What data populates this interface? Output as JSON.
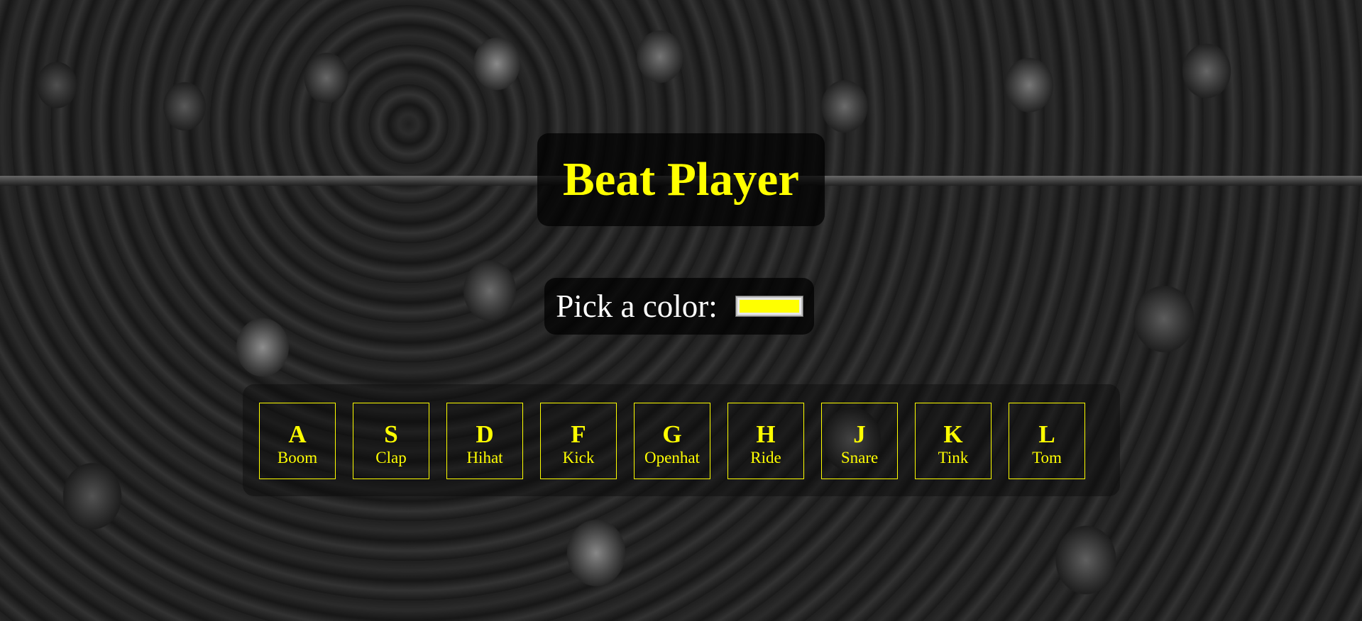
{
  "page": {
    "title": "Beat Player",
    "background_description_icon": "crowd-photo"
  },
  "color_picker": {
    "label": "Pick a color:",
    "value": "#ffff00"
  },
  "keys": [
    {
      "key": "A",
      "sound": "Boom"
    },
    {
      "key": "S",
      "sound": "Clap"
    },
    {
      "key": "D",
      "sound": "Hihat"
    },
    {
      "key": "F",
      "sound": "Kick"
    },
    {
      "key": "G",
      "sound": "Openhat"
    },
    {
      "key": "H",
      "sound": "Ride"
    },
    {
      "key": "J",
      "sound": "Snare"
    },
    {
      "key": "K",
      "sound": "Tink"
    },
    {
      "key": "L",
      "sound": "Tom"
    }
  ],
  "colors": {
    "accent": "#ffff00",
    "label": "#ffffff",
    "panel": "#000000"
  }
}
